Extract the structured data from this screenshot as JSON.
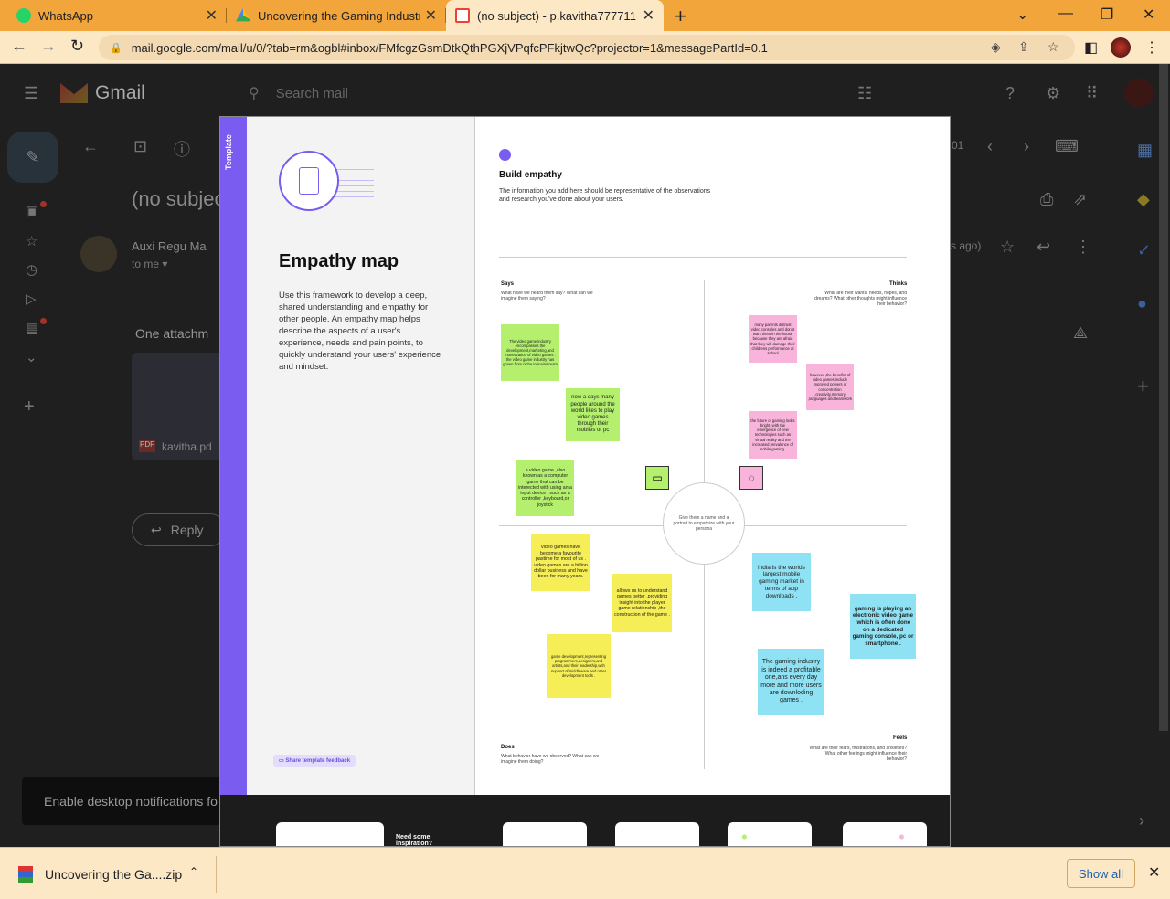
{
  "tabs": [
    {
      "title": "WhatsApp",
      "color": "#25d366"
    },
    {
      "title": "Uncovering the Gaming Industry",
      "color": "#4285f4"
    },
    {
      "title": "(no subject) - p.kavitha777711@g",
      "color": "#ea4335"
    }
  ],
  "address": {
    "url": "mail.google.com/mail/u/0/?tab=rm&ogbl#inbox/FMfcgzGsmDtkQthPGXjVPqfcPFkjtwQc?projector=1&messagePartId=0.1"
  },
  "gmail": {
    "product": "Gmail",
    "search_placeholder": "Search mail",
    "subject": "(no subjec",
    "sender": "Auxi Regu Ma",
    "to": "to me",
    "time": "s ago)",
    "page_count": "01",
    "attachments_heading": "One attachm",
    "attachment_name": "kavitha.pd",
    "attachment_type": "PDF",
    "reply": "Reply",
    "notification": "Enable desktop notifications fo"
  },
  "template": {
    "side_label": "Template",
    "title": "Empathy map",
    "description": "Use this framework to develop a deep, shared understanding and empathy for other people. An empathy map helps describe the aspects of a user's experience, needs and pain points, to quickly understand your users' experience and mindset.",
    "feedback": "Share template feedback",
    "need_help": "Need some inspiration?"
  },
  "board": {
    "title": "Build empathy",
    "description": "The information you add here should be representative of the observations and research you've done about your users.",
    "center": "Give them a name and a portrait to empathize with your persona",
    "says": {
      "label": "Says",
      "sub": "What have we heard them say? What can we imagine them saying?"
    },
    "thinks": {
      "label": "Thinks",
      "sub": "What are their wants, needs, hopes, and dreams? What other thoughts might influence their behavior?"
    },
    "does": {
      "label": "Does",
      "sub": "What behavior have we observed? What can we imagine them doing?"
    },
    "feels": {
      "label": "Feels",
      "sub": "What are their fears, frustrations, and anxieties? What other feelings might influence their behavior?"
    }
  },
  "notes": {
    "g1": "The video game industry encompasses the development,marketing,and monetization of video games . the video game industry has grown from niche to mainstream",
    "g2": "now a days many people around the world likes to play video games through their mobiles or pc",
    "g3": "a video game ,also known as a computer game that can be interected with using an a input device , such as a controller ,keyboard,or joystick",
    "p1": "many parents distrust video consoles and donot want them in the house because they are afraid that they will damage their childrens performance at school",
    "p2": "however ,the benefits of video games include improved powers of concentration ,creativity,memory ,languages and teamwork",
    "p3": "the future of gaming looks bright, with the emergence of new technologies such as virtual reality and the increased prevalence of mobile gaming .",
    "y1": "video games have become a favourite pastime for most of us . video games are a billion dollar business and have been for many years.",
    "y2": "allows us to understand games better ,providing insight into the player game relationship ,the construction of the game .",
    "y3": "game development,representing programmers,designers,and artists,and their leadership,with support of middleware and other development tools .",
    "b1": "india is the worlds largest mobile gaming market in terms of app downloads .",
    "b2": "gaming is playing an electronic video game ,which is often done on a dedicated gaming console, pc or smartphone .",
    "b3": "The gaming industry is indeed a profitable one,ans every day more and more users are downloding games ."
  },
  "download": {
    "file": "Uncovering the Ga....zip",
    "show_all": "Show all"
  }
}
